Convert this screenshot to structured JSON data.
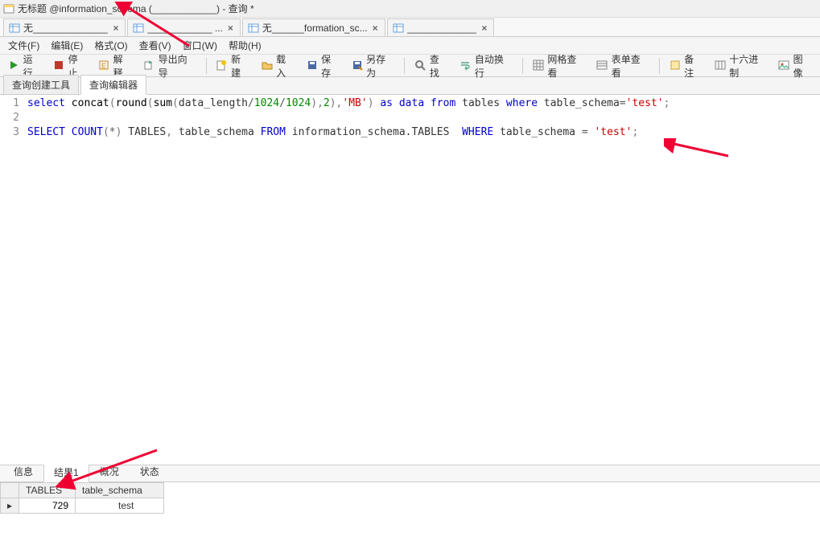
{
  "window": {
    "title": "无标题 @information_schema (____________) - 查询 *"
  },
  "docTabs": [
    {
      "icon": "table",
      "label": "无______________",
      "close": "×"
    },
    {
      "icon": "table",
      "label": "____________ ...",
      "close": "×"
    },
    {
      "icon": "table",
      "label": "无______formation_sc...",
      "close": "×"
    },
    {
      "icon": "table",
      "label": "_____________",
      "close": "×"
    }
  ],
  "menus": [
    "文件(F)",
    "编辑(E)",
    "格式(O)",
    "查看(V)",
    "窗口(W)",
    "帮助(H)"
  ],
  "toolbar": {
    "run": "运行",
    "stop": "停止",
    "explain": "解释",
    "export": "导出向导",
    "new": "新建",
    "load": "载入",
    "save": "保存",
    "saveas": "另存为",
    "find": "查找",
    "wrap": "自动换行",
    "gridview": "网格查看",
    "formview": "表单查看",
    "notes": "备注",
    "hex": "十六进制",
    "image": "图像"
  },
  "subTabs": {
    "builder": "查询创建工具",
    "editor": "查询编辑器"
  },
  "code": {
    "lines": [
      "1",
      "2",
      "3"
    ],
    "l1": {
      "select": "select",
      "concat": "concat",
      "round": "round",
      "sum": "sum",
      "field": "data_length",
      "n1": "1024",
      "n2": "1024",
      "two": "2",
      "mb": "'MB'",
      "as": "as",
      "alias": "data",
      "from": "from",
      "tables": "tables",
      "where": "where",
      "col": "table_schema",
      "eq": "=",
      "val": "'test'",
      "semi": ";"
    },
    "l3": {
      "select": "SELECT",
      "count": "COUNT",
      "star": "*",
      "tables": "TABLES",
      "comma": ",",
      "col1": "table_schema",
      "from": "FROM",
      "schema": "information_schema.TABLES",
      "where": "WHERE",
      "col2": "table_schema",
      "eq": "=",
      "val": "'test'",
      "semi": ";"
    }
  },
  "bottomTabs": [
    "信息",
    "结果1",
    "概况",
    "状态"
  ],
  "result": {
    "headers": [
      "TABLES",
      "table_schema"
    ],
    "row": {
      "tables": "729",
      "schema_suffix": "test"
    }
  }
}
